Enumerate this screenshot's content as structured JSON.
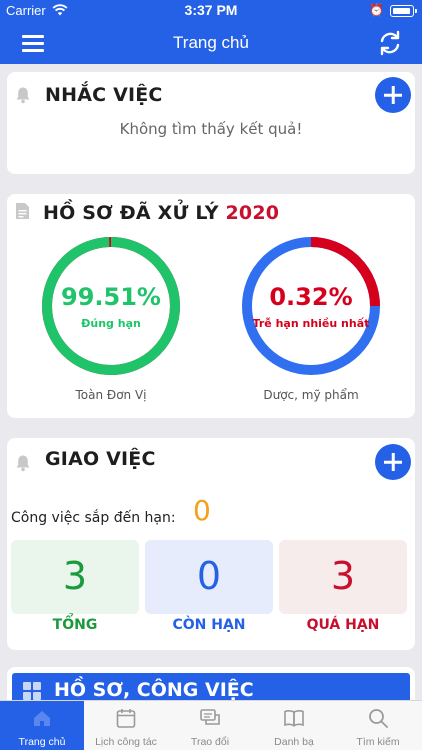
{
  "status_bar": {
    "carrier": "Carrier",
    "time": "3:37 PM"
  },
  "nav": {
    "title": "Trang chủ"
  },
  "nhac_viec": {
    "title": "NHẮC VIỆC",
    "empty_text": "Không tìm thấy kết quả!"
  },
  "ho_so": {
    "title": "HỒ SƠ ĐÃ XỬ LÝ",
    "year": "2020",
    "charts": [
      {
        "percent": "99.51%",
        "percent_value": 99.51,
        "label": "Đúng hạn",
        "caption": "Toàn Đơn Vị",
        "color": "#1fc46a",
        "rest_color": "#d6001c"
      },
      {
        "percent": "0.32%",
        "percent_value": 0.32,
        "label": "Trễ hạn nhiều nhất",
        "caption": "Dược, mỹ phẩm",
        "color": "#d6001c",
        "rest_color": "#2f6ff0"
      }
    ]
  },
  "giao_viec": {
    "title": "GIAO VIỆC",
    "due_label": "Công việc sắp đến hạn:",
    "due_count": "0",
    "stats": [
      {
        "value": "3",
        "label": "TỔNG",
        "color": "#1a9a3a",
        "bg": "#eaf6ec"
      },
      {
        "value": "0",
        "label": "CÒN HẠN",
        "color": "#2461e6",
        "bg": "#e6ecfb"
      },
      {
        "value": "3",
        "label": "QUÁ HẠN",
        "color": "#c8102e",
        "bg": "#f7ecec"
      }
    ]
  },
  "ho_so_cong_viec": {
    "title": "HỒ SƠ, CÔNG VIỆC"
  },
  "tabs": [
    {
      "label": "Trang chủ",
      "icon": "home-icon",
      "active": true
    },
    {
      "label": "Lịch công tác",
      "icon": "calendar-icon",
      "active": false
    },
    {
      "label": "Trao đổi",
      "icon": "chat-icon",
      "active": false
    },
    {
      "label": "Danh bạ",
      "icon": "book-icon",
      "active": false
    },
    {
      "label": "Tìm kiếm",
      "icon": "search-icon",
      "active": false
    }
  ]
}
